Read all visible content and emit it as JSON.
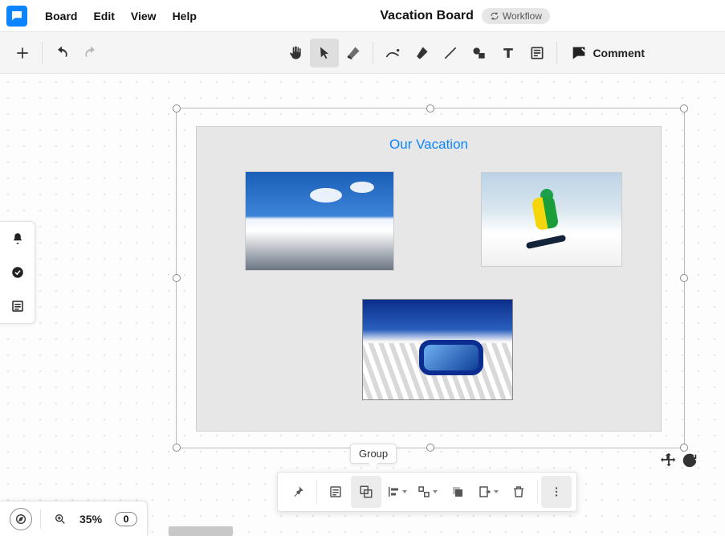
{
  "menubar": {
    "items": [
      "Board",
      "Edit",
      "View",
      "Help"
    ],
    "board_title": "Vacation Board",
    "workflow_label": "Workflow"
  },
  "toolbar": {
    "add_label": "Add",
    "undo_label": "Undo",
    "redo_label": "Redo",
    "hand_label": "Hand",
    "pointer_label": "Select",
    "eraser_label": "Eraser",
    "pen_label": "Pen",
    "marker_label": "Marker",
    "line_label": "Line",
    "shape_label": "Shape",
    "text_label": "Text",
    "note_label": "Note",
    "comment_label": "Comment"
  },
  "card": {
    "title": "Our Vacation",
    "images": [
      {
        "alt": "Snowy mountain range with blue sky"
      },
      {
        "alt": "Snowboarder in yellow and green jacket"
      },
      {
        "alt": "Blue ski goggles on groomed snow"
      }
    ]
  },
  "tooltip": {
    "group": "Group"
  },
  "context_bar": {
    "pin": "Pin",
    "list": "List",
    "group": "Group",
    "align": "Align",
    "distribute": "Distribute",
    "bring": "Bring to front",
    "send": "Send to back",
    "delete": "Delete",
    "more": "More"
  },
  "zoom": {
    "value": "35%",
    "objects": "0"
  }
}
